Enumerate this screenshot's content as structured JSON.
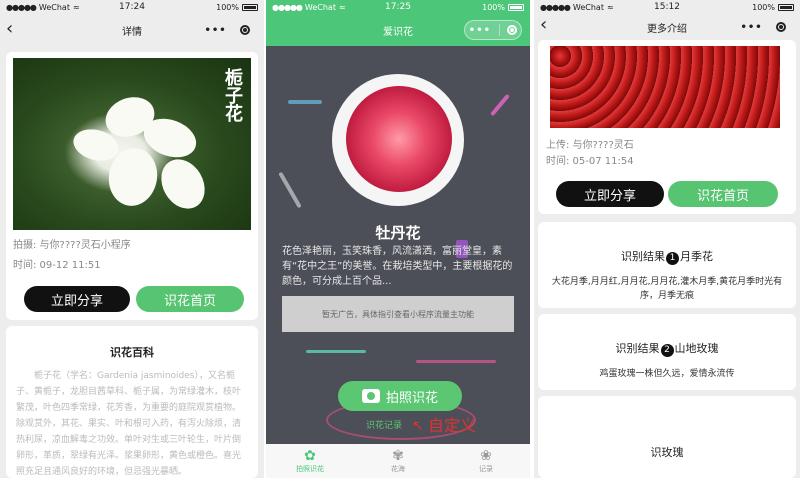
{
  "statusbar": {
    "carrier": "WeChat",
    "battery": "100%",
    "times": [
      "17:24",
      "17:25",
      "15:12"
    ]
  },
  "screen1": {
    "nav_title": "详情",
    "flower_vertical_title": "栀子花",
    "upload_by": "拍摄: 与你????灵石小程序",
    "time": "时间: 09-12 11:51",
    "share_button": "立即分享",
    "home_button": "识花首页",
    "encyclopedia_title": "识花百科",
    "encyclopedia_text": "栀子花（学名：Gardenia jasminoides），又名栀子、黄栀子，龙胆目茜草科、栀子属，为常绿灌木，枝叶繁茂，叶色四季常绿，花芳香，为重要的庭院观赏植物。除观赏外，其花、果实、叶和根可入药，有泻火除烦，清热利尿，凉血解毒之功效。单叶对生或三叶轮生，叶片倒卵形，革质，翠绿有光泽。浆果卵形，黄色或橙色。喜光照充足且通风良好的环境，但忌强光暴晒。"
  },
  "screen2": {
    "nav_title": "爱识花",
    "flower_name": "牡丹花",
    "flower_desc": "花色泽艳丽，玉笑珠香，风流潇洒，富丽堂皇，素有“花中之王”的美誉。在栽培类型中，主要根据花的颜色，可分成上百个品...",
    "ad_text": "暂无广告，具体指引查看小程序流量主功能",
    "photo_button": "拍照识花",
    "small_link": "识花记录",
    "custom_note": "自定义",
    "tabs": [
      {
        "label": "拍照识花",
        "icon": "flower-icon"
      },
      {
        "label": "花海",
        "icon": "flower-glyph-icon"
      },
      {
        "label": "记录",
        "icon": "paw-icon"
      }
    ]
  },
  "screen3": {
    "nav_title": "更多介绍",
    "upload_by": "上传: 与你????灵石",
    "time": "时间: 05-07 11:54",
    "share_button": "立即分享",
    "home_button": "识花首页",
    "results": [
      {
        "prefix": "识别结果",
        "num": "1",
        "name": "月季花",
        "desc": "大花月季,月月红,月月花,月月花,灌木月季,黄花月季时光有序，月季无痕"
      },
      {
        "prefix": "识别结果",
        "num": "2",
        "name": "山地玫瑰",
        "desc": "鸡蛋玫瑰一株但久远，爱情永流传"
      }
    ],
    "third_title": "识玫瑰"
  },
  "colors": {
    "green": "#57c472",
    "black": "#111111",
    "header_green": "#4cc678"
  }
}
